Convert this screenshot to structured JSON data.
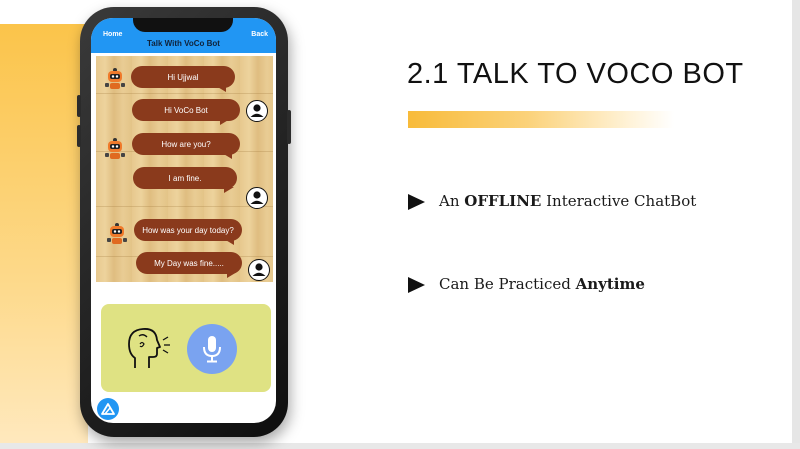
{
  "slide": {
    "title": "2.1 TALK TO VOCO BOT",
    "bullets": [
      {
        "pre": "An ",
        "bold": "OFFLINE",
        "post": " Interactive ChatBot"
      },
      {
        "pre": "Can Be Practiced ",
        "bold": "Anytime",
        "post": ""
      }
    ],
    "colors": {
      "accent": "#fbc44a",
      "bubble": "#8a3a1c",
      "header": "#2196f3",
      "panel": "#dfe283",
      "mic": "#7aa3f0"
    }
  },
  "app": {
    "header": {
      "home": "Home",
      "title": "Talk With VoCo Bot",
      "back": "Back"
    },
    "messages": [
      {
        "sender": "bot",
        "text": "Hi Ujjwal"
      },
      {
        "sender": "user",
        "text": "Hi VoCo Bot"
      },
      {
        "sender": "bot",
        "text": "How are you?"
      },
      {
        "sender": "user",
        "text": "I am fine."
      },
      {
        "sender": "bot",
        "text": "How was your day today?"
      },
      {
        "sender": "user",
        "text": "My Day was fine....."
      }
    ],
    "icons": {
      "bot": "robot-icon",
      "user": "user-avatar-icon",
      "speak": "speaking-head-icon",
      "mic": "microphone-icon",
      "fab": "app-logo-icon"
    }
  }
}
